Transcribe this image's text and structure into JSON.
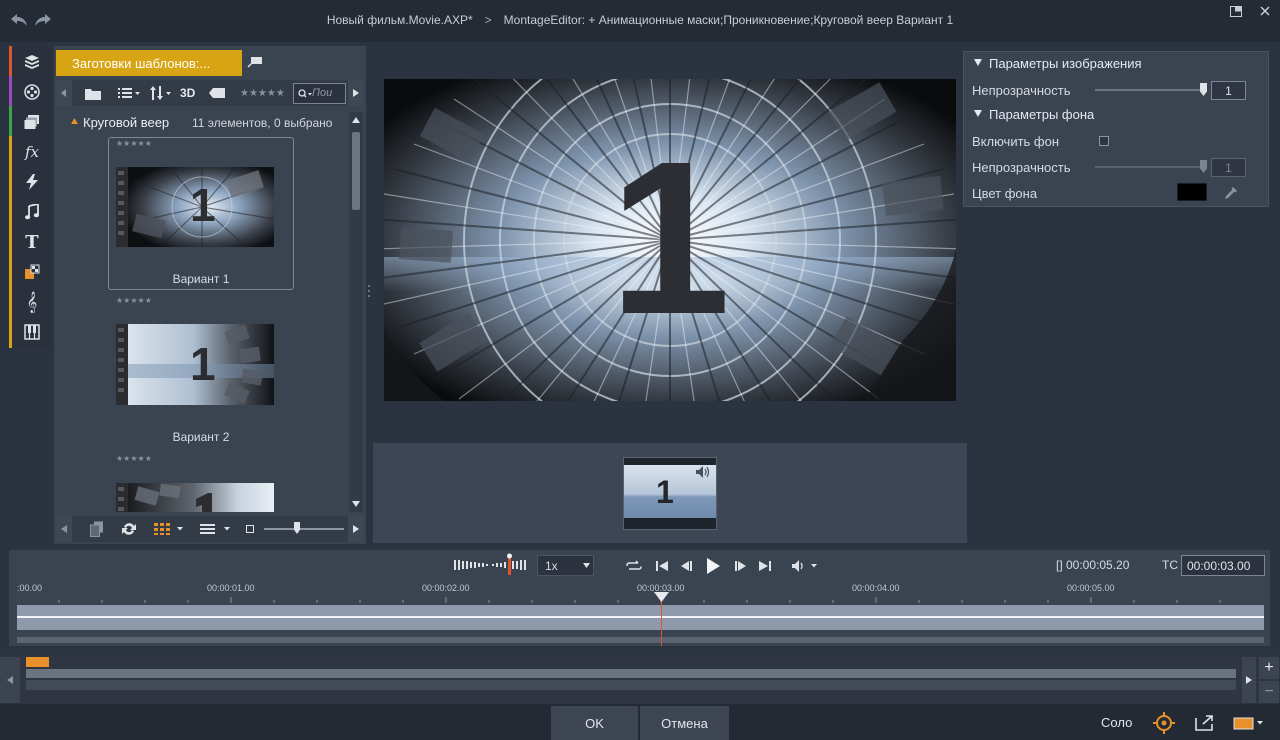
{
  "titlebar": {
    "project": "Новый фильм.Movie.AXP",
    "modified": "*",
    "separator": ">",
    "path": "MontageEditor: + Анимационные маски;Проникновение;Круговой веер  Вариант 1"
  },
  "library": {
    "tab_label": "Заготовки шаблонов:...",
    "toolbar_3d": "3D",
    "toolbar_stars": "★★★★★",
    "search_placeholder": "Пои",
    "group_name": "Круговой веер",
    "group_info": "11 элементов, 0 выбрано",
    "items": [
      {
        "label": "Вариант 1",
        "stars": "★★★★★"
      },
      {
        "label": "Вариант 2",
        "stars": "★★★★★"
      },
      {
        "label": "",
        "stars": "★★★★★"
      }
    ],
    "thumb_digit": "1"
  },
  "preview": {
    "digit": "1"
  },
  "params": {
    "image_section": "Параметры изображения",
    "opacity_label": "Непрозрачность",
    "opacity_value": "1",
    "opacity_level": 1.0,
    "bg_section": "Параметры фона",
    "enable_bg_label": "Включить фон",
    "enable_bg_checked": false,
    "bg_opacity_label": "Непрозрачность",
    "bg_opacity_value": "1",
    "bg_color_label": "Цвет фона",
    "bg_color": "#000000"
  },
  "strip": {
    "digit": "1"
  },
  "transport": {
    "speed": "1x",
    "duration": "[] 00:00:05.20",
    "tc_label": "TC",
    "tc_value": "00:00:03.00",
    "ruler": [
      ":00.00",
      "00:00:01.00",
      "00:00:02.00",
      "00:00:03.00",
      "00:00:04.00",
      "00:00:05.00"
    ]
  },
  "overview": {
    "plus": "+",
    "minus": "−"
  },
  "footer": {
    "ok": "OK",
    "cancel": "Отмена",
    "solo": "Соло"
  },
  "colors": {
    "accent": "#d7a413",
    "playhead": "#e0542a",
    "marker": "#e8912a"
  }
}
